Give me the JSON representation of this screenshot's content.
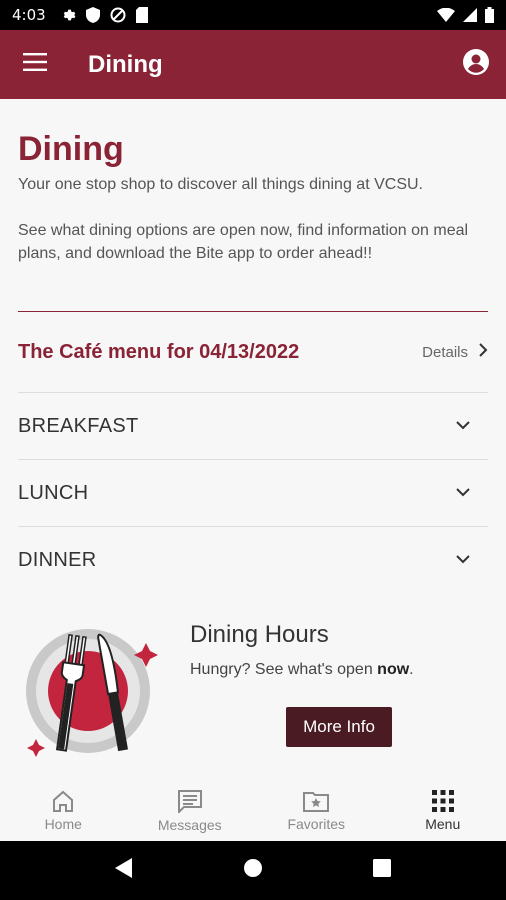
{
  "status_bar": {
    "time": "4:03",
    "left_icons": [
      "gear-icon",
      "shield-icon",
      "data-saver-icon",
      "sim-card-icon"
    ],
    "right_icons": [
      "wifi-icon",
      "signal-icon",
      "battery-icon"
    ]
  },
  "app_bar": {
    "title": "Dining",
    "menu_icon": "hamburger-menu-icon",
    "account_icon": "account-circle-icon"
  },
  "page": {
    "title": "Dining",
    "intro": "Your one stop shop to discover all things dining at VCSU.",
    "intro2": "See what dining options are open now, find information on meal plans, and download the Bite app to order ahead!!"
  },
  "cafe_menu": {
    "heading": "The Café menu for 04/13/2022",
    "details_label": "Details",
    "meals": [
      {
        "label": "BREAKFAST"
      },
      {
        "label": "LUNCH"
      },
      {
        "label": "DINNER"
      }
    ]
  },
  "hours": {
    "title": "Dining Hours",
    "subtitle_prefix": "Hungry? See what's open ",
    "subtitle_bold": "now",
    "subtitle_suffix": ".",
    "button_label": "More Info"
  },
  "bottom_nav": {
    "items": [
      {
        "label": "Home",
        "icon": "home-icon",
        "active": false
      },
      {
        "label": "Messages",
        "icon": "messages-icon",
        "active": false
      },
      {
        "label": "Favorites",
        "icon": "favorites-folder-icon",
        "active": false
      },
      {
        "label": "Menu",
        "icon": "grid-menu-icon",
        "active": true
      }
    ]
  },
  "colors": {
    "brand": "#8a2336",
    "button_dark": "#4a1b23"
  }
}
